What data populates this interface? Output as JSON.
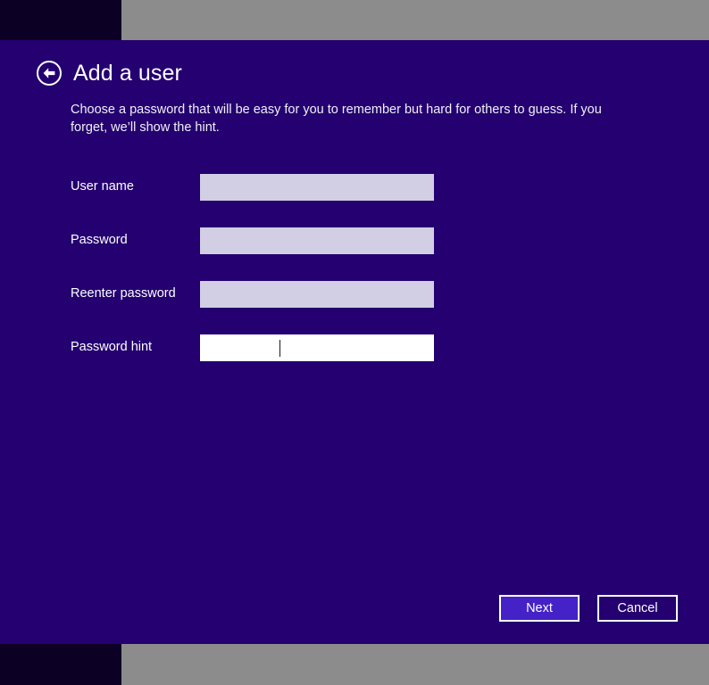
{
  "window": {
    "title": "Add a user",
    "background_color": "#240070",
    "desktop_strip_color": "#8c8c8c",
    "corner_color": "#0c0124"
  },
  "header": {
    "back_icon": "back-arrow-circle-icon",
    "title": "Add a user"
  },
  "description": "Choose a password that will be easy for you to remember but hard for others to guess. If you forget, we’ll show the hint.",
  "form": {
    "fields": [
      {
        "label": "User name",
        "value": "",
        "placeholder": "",
        "type": "text",
        "focused": false
      },
      {
        "label": "Password",
        "value": "",
        "placeholder": "",
        "type": "password",
        "focused": false
      },
      {
        "label": "Reenter password",
        "value": "",
        "placeholder": "",
        "type": "password",
        "focused": false
      },
      {
        "label": "Password hint",
        "value": "",
        "placeholder": "",
        "type": "text",
        "focused": true
      }
    ]
  },
  "footer": {
    "next_label": "Next",
    "cancel_label": "Cancel",
    "primary_color": "#4422c8"
  }
}
